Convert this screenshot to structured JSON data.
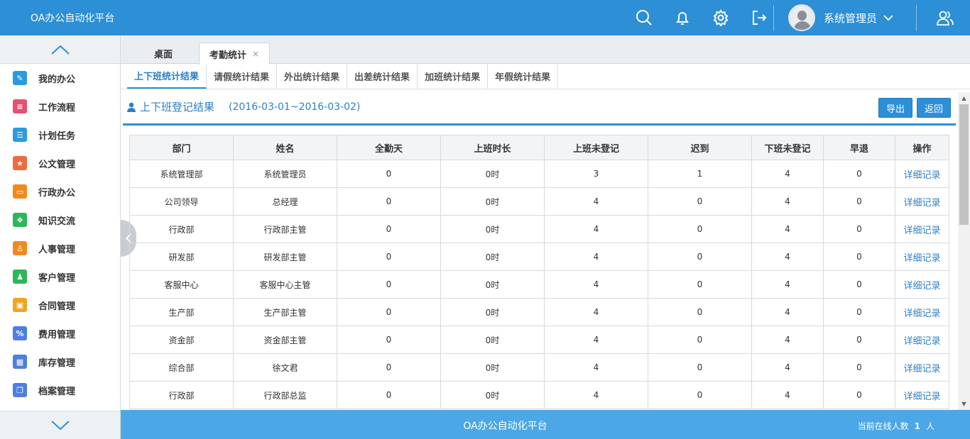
{
  "app_title": "OA办公自动化平台",
  "user": {
    "name": "系统管理员"
  },
  "top_icons": [
    "search-icon",
    "bell-icon",
    "gear-icon",
    "logout-icon"
  ],
  "sidebar": {
    "items": [
      {
        "label": "我的办公",
        "icon": "edit-icon",
        "color": "#2b9be0",
        "glyph": "✎"
      },
      {
        "label": "工作流程",
        "icon": "flow-icon",
        "color": "#e8506f",
        "glyph": "≡"
      },
      {
        "label": "计划任务",
        "icon": "list-icon",
        "color": "#2b9be0",
        "glyph": "☰"
      },
      {
        "label": "公文管理",
        "icon": "star-icon",
        "color": "#ef6b3b",
        "glyph": "★"
      },
      {
        "label": "行政办公",
        "icon": "folder-icon",
        "color": "#f08a1e",
        "glyph": "▭"
      },
      {
        "label": "知识交流",
        "icon": "leaf-icon",
        "color": "#2db65b",
        "glyph": "❖"
      },
      {
        "label": "人事管理",
        "icon": "person-icon",
        "color": "#f08a1e",
        "glyph": "♙"
      },
      {
        "label": "客户管理",
        "icon": "contact-icon",
        "color": "#2db65b",
        "glyph": "♟"
      },
      {
        "label": "合同管理",
        "icon": "contract-icon",
        "color": "#f0a51e",
        "glyph": "▣"
      },
      {
        "label": "费用管理",
        "icon": "percent-icon",
        "color": "#4c7fe0",
        "glyph": "%"
      },
      {
        "label": "库存管理",
        "icon": "grid-icon",
        "color": "#4c7fe0",
        "glyph": "▦"
      },
      {
        "label": "档案管理",
        "icon": "copy-icon",
        "color": "#4c7fe0",
        "glyph": "❐"
      }
    ]
  },
  "window_tabs": {
    "desk": "桌面",
    "active": "考勤统计",
    "close": "×"
  },
  "subtabs": [
    "上下班统计结果",
    "请假统计结果",
    "外出统计结果",
    "出差统计结果",
    "加班统计结果",
    "年假统计结果"
  ],
  "section": {
    "title": "上下班登记结果",
    "range": "(2016-03-01~2016-03-02)",
    "export_label": "导出",
    "back_label": "返回"
  },
  "table": {
    "headers": [
      "部门",
      "姓名",
      "全勤天",
      "上班时长",
      "上班未登记",
      "迟到",
      "下班未登记",
      "早退",
      "操作"
    ],
    "rows": [
      [
        "系统管理部",
        "系统管理员",
        "0",
        "0时",
        "3",
        "1",
        "4",
        "0",
        "详细记录"
      ],
      [
        "公司领导",
        "总经理",
        "0",
        "0时",
        "4",
        "0",
        "4",
        "0",
        "详细记录"
      ],
      [
        "行政部",
        "行政部主管",
        "0",
        "0时",
        "4",
        "0",
        "4",
        "0",
        "详细记录"
      ],
      [
        "研发部",
        "研发部主管",
        "0",
        "0时",
        "4",
        "0",
        "4",
        "0",
        "详细记录"
      ],
      [
        "客服中心",
        "客服中心主管",
        "0",
        "0时",
        "4",
        "0",
        "4",
        "0",
        "详细记录"
      ],
      [
        "生产部",
        "生产部主管",
        "0",
        "0时",
        "4",
        "0",
        "4",
        "0",
        "详细记录"
      ],
      [
        "资金部",
        "资金部主管",
        "0",
        "0时",
        "4",
        "0",
        "4",
        "0",
        "详细记录"
      ],
      [
        "综合部",
        "徐文君",
        "0",
        "0时",
        "4",
        "0",
        "4",
        "0",
        "详细记录"
      ],
      [
        "行政部",
        "行政部总监",
        "0",
        "0时",
        "4",
        "0",
        "4",
        "0",
        "详细记录"
      ]
    ]
  },
  "footer": {
    "title": "OA办公自动化平台",
    "online_label": "当前在线人数",
    "online_count": "1",
    "online_unit": "人"
  },
  "colors": {
    "primary": "#2d8fd6",
    "footer": "#4ba7e5",
    "link": "#2d7fc7"
  }
}
